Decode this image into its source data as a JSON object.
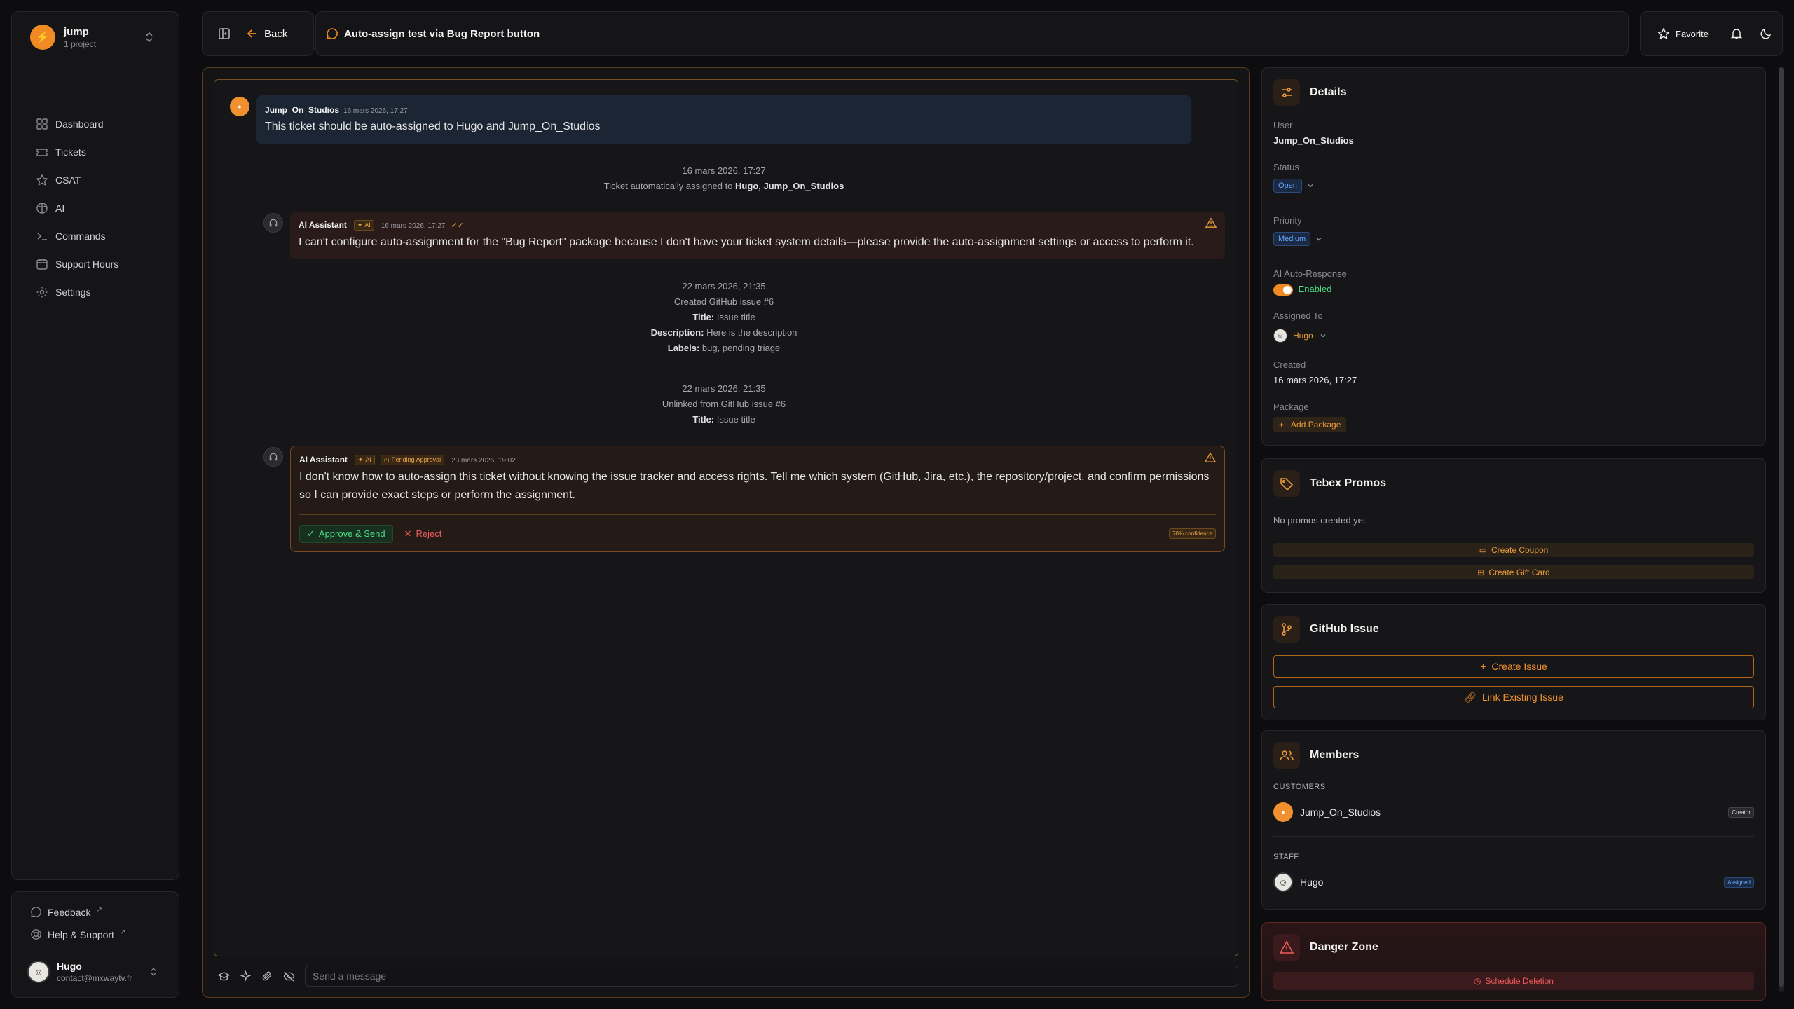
{
  "workspace": {
    "name": "jump",
    "subtitle": "1 project"
  },
  "nav": [
    {
      "label": "Dashboard",
      "icon": "dashboard-icon"
    },
    {
      "label": "Tickets",
      "icon": "ticket-icon"
    },
    {
      "label": "CSAT",
      "icon": "star-icon"
    },
    {
      "label": "AI",
      "icon": "ai-icon"
    },
    {
      "label": "Commands",
      "icon": "terminal-icon"
    },
    {
      "label": "Support Hours",
      "icon": "calendar-icon"
    },
    {
      "label": "Settings",
      "icon": "gear-icon"
    }
  ],
  "footer": {
    "feedback": "Feedback",
    "help": "Help & Support",
    "user_name": "Hugo",
    "user_email": "contact@mxwaytv.fr"
  },
  "topbar": {
    "back": "Back",
    "ticket_title": "Auto-assign test via Bug Report button",
    "favorite": "Favorite"
  },
  "chat": {
    "user_msg": {
      "author": "Jump_On_Studios",
      "time": "16 mars 2026, 17:27",
      "text": "This ticket should be auto-assigned to Hugo and Jump_On_Studios"
    },
    "sys1": {
      "time": "16 mars 2026, 17:27",
      "prefix": "Ticket automatically assigned to",
      "names": "Hugo, Jump_On_Studios"
    },
    "ai1": {
      "author": "AI Assistant",
      "badge": "AI",
      "time": "16 mars 2026, 17:27",
      "text": "I can't configure auto-assignment for the \"Bug Report\" package because I don't have your ticket system details—please provide the auto-assignment settings or access to perform it."
    },
    "sys2": {
      "time": "22 mars 2026, 21:35",
      "line": "Created GitHub issue #6",
      "title_label": "Title:",
      "title": "Issue title",
      "desc_label": "Description:",
      "desc": "Here is the description",
      "labels_label": "Labels:",
      "labels": "bug, pending triage"
    },
    "sys3": {
      "time": "22 mars 2026, 21:35",
      "line": "Unlinked from GitHub issue #6",
      "title_label": "Title:",
      "title": "Issue title"
    },
    "ai2": {
      "author": "AI Assistant",
      "badge": "AI",
      "pending": "Pending Approval",
      "time": "23 mars 2026, 19:02",
      "text": "I don't know how to auto-assign this ticket without knowing the issue tracker and access rights. Tell me which system (GitHub, Jira, etc.), the repository/project, and confirm permissions so I can provide exact steps or perform the assignment.",
      "approve": "Approve & Send",
      "reject": "Reject",
      "confidence": "70% confidence"
    },
    "input_placeholder": "Send a message"
  },
  "details": {
    "title": "Details",
    "user_label": "User",
    "user": "Jump_On_Studios",
    "status_label": "Status",
    "status": "Open",
    "priority_label": "Priority",
    "priority": "Medium",
    "ai_label": "AI Auto-Response",
    "ai_value": "Enabled",
    "assigned_label": "Assigned To",
    "assigned": "Hugo",
    "created_label": "Created",
    "created": "16 mars 2026, 17:27",
    "package_label": "Package",
    "add_package": "Add Package"
  },
  "promos": {
    "title": "Tebex Promos",
    "empty": "No promos created yet.",
    "coupon": "Create Coupon",
    "gift": "Create Gift Card"
  },
  "github": {
    "title": "GitHub Issue",
    "create": "Create Issue",
    "link": "Link Existing Issue"
  },
  "members": {
    "title": "Members",
    "customers_label": "CUSTOMERS",
    "customer": "Jump_On_Studios",
    "customer_tag": "Creator",
    "staff_label": "STAFF",
    "staff": "Hugo",
    "staff_tag": "Assigned"
  },
  "danger": {
    "title": "Danger Zone",
    "schedule": "Schedule Deletion"
  },
  "colors": {
    "accent": "#f08a24",
    "danger": "#ef5a5a",
    "success": "#4ade80",
    "info": "#6aa7ff"
  }
}
